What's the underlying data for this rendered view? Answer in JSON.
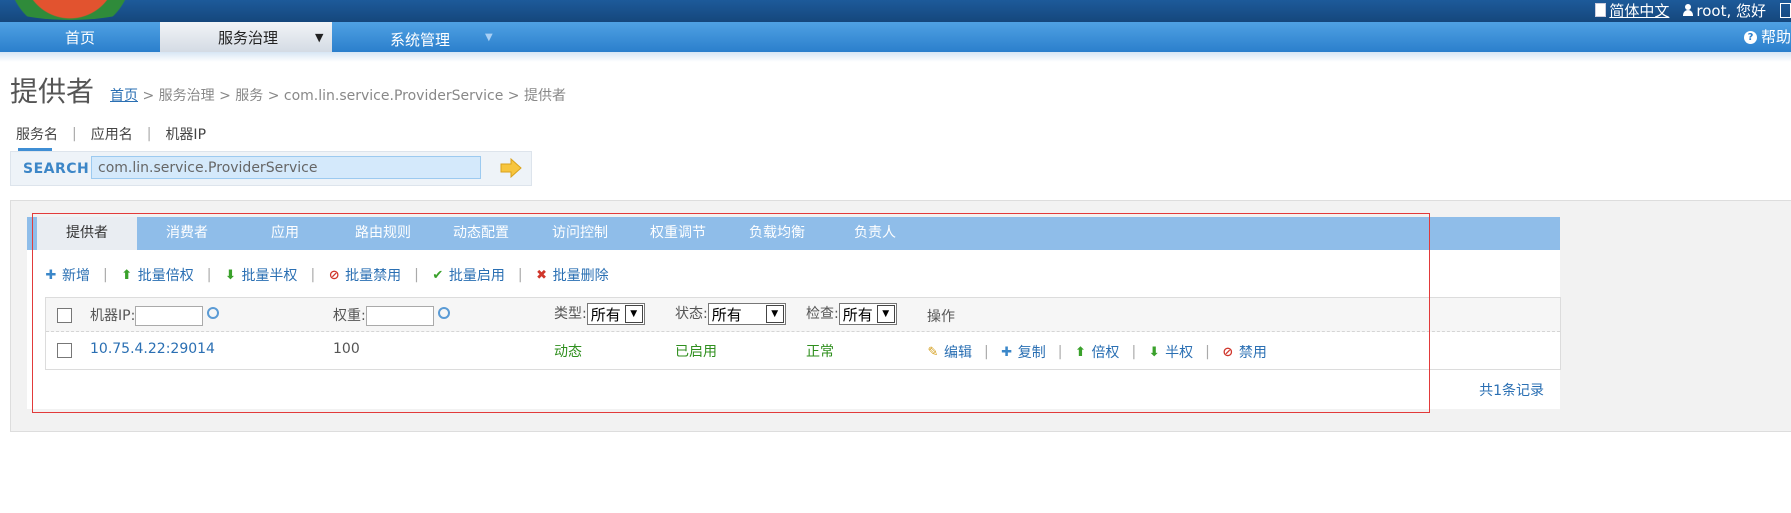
{
  "header": {
    "language_link": "简体中文",
    "greeting": "root, 您好",
    "help": "帮助"
  },
  "nav": {
    "items": [
      "首页",
      "服务治理",
      "系统管理"
    ]
  },
  "page": {
    "title": "提供者",
    "breadcrumb": {
      "home": "首页",
      "rest": "> 服务治理 > 服务 > com.lin.service.ProviderService > 提供者"
    }
  },
  "search": {
    "tabs": [
      "服务名",
      "应用名",
      "机器IP"
    ],
    "label": "SEARCH",
    "value": "com.lin.service.ProviderService"
  },
  "tabs": [
    "提供者",
    "消费者",
    "应用",
    "路由规则",
    "动态配置",
    "访问控制",
    "权重调节",
    "负载均衡",
    "负责人"
  ],
  "toolbar": {
    "add": "新增",
    "batch_double": "批量倍权",
    "batch_half": "批量半权",
    "batch_disable": "批量禁用",
    "batch_enable": "批量启用",
    "batch_delete": "批量删除"
  },
  "table": {
    "filters": {
      "ip_label": "机器IP:",
      "weight_label": "权重:",
      "type_label": "类型:",
      "type_value": "所有",
      "status_label": "状态:",
      "status_value": "所有",
      "check_label": "检查:",
      "check_value": "所有",
      "ops_label": "操作"
    },
    "rows": [
      {
        "ip": "10.75.4.22:29014",
        "weight": "100",
        "type": "动态",
        "status": "已启用",
        "check": "正常",
        "actions": [
          "编辑",
          "复制",
          "倍权",
          "半权",
          "禁用"
        ]
      }
    ],
    "total": "共1条记录"
  }
}
